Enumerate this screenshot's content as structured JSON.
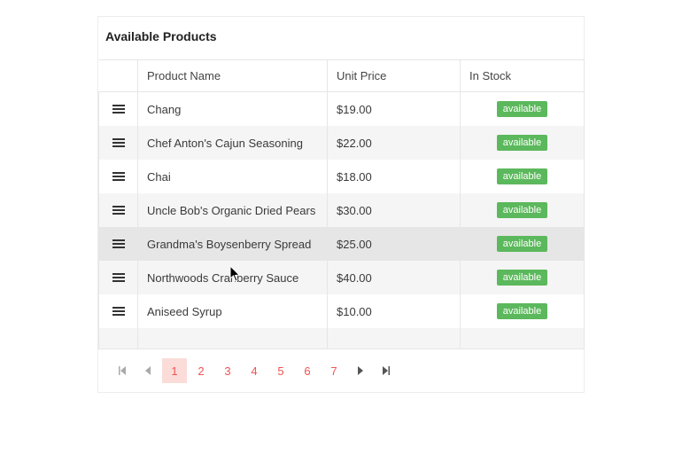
{
  "title": "Available Products",
  "columns": {
    "name": "Product Name",
    "price": "Unit Price",
    "stock": "In Stock"
  },
  "rows": [
    {
      "name": "Chang",
      "price": "$19.00",
      "stock": "available"
    },
    {
      "name": "Chef Anton's Cajun Seasoning",
      "price": "$22.00",
      "stock": "available"
    },
    {
      "name": "Chai",
      "price": "$18.00",
      "stock": "available"
    },
    {
      "name": "Uncle Bob's Organic Dried Pears",
      "price": "$30.00",
      "stock": "available"
    },
    {
      "name": "Grandma's Boysenberry Spread",
      "price": "$25.00",
      "stock": "available"
    },
    {
      "name": "Northwoods Cranberry Sauce",
      "price": "$40.00",
      "stock": "available"
    },
    {
      "name": "Aniseed Syrup",
      "price": "$10.00",
      "stock": "available"
    }
  ],
  "pager": {
    "pages": [
      "1",
      "2",
      "3",
      "4",
      "5",
      "6",
      "7"
    ],
    "selected": "1"
  }
}
